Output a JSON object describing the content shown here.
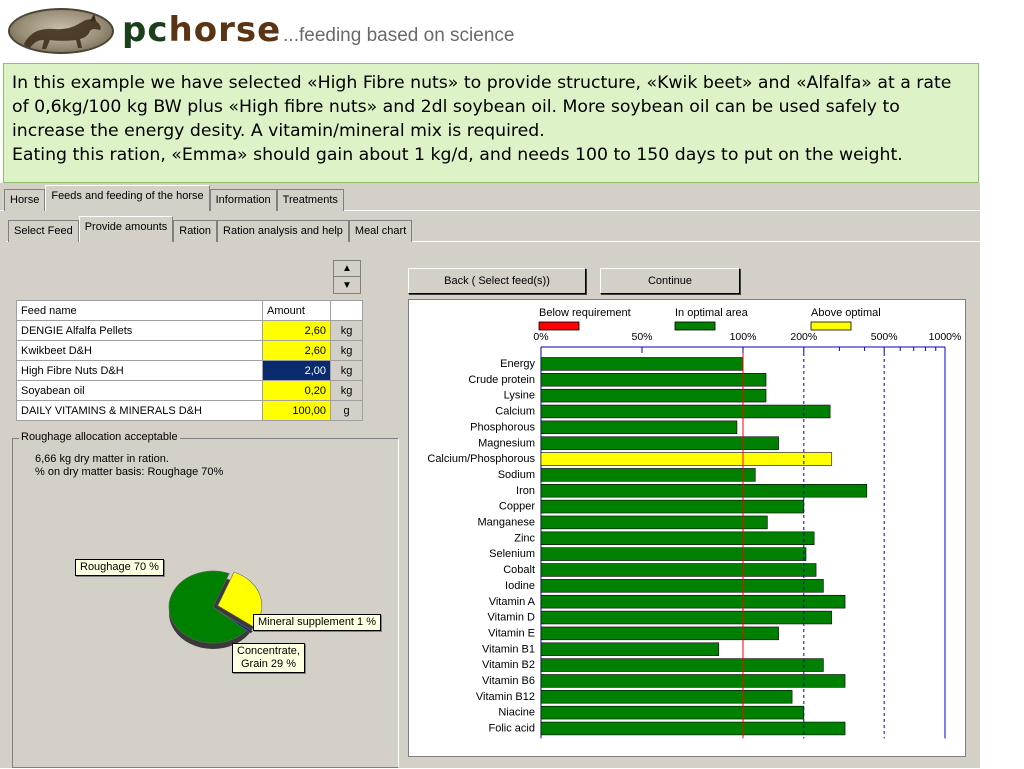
{
  "header": {
    "brand_pc": "pc",
    "brand_horse": "horse",
    "tagline": "...feeding based on science"
  },
  "caption": {
    "line1": "In this example we have selected «High Fibre nuts» to provide structure, «Kwik beet» and «Alfalfa» at a rate of 0,6kg/100 kg BW plus «High fibre nuts» and 2dl soybean oil. More soybean oil can be used safely to increase the energy desity.  A vitamin/mineral mix is required.",
    "line2": "Eating this ration, «Emma» should gain about 1 kg/d, and needs 100 to 150 days to put on the weight."
  },
  "tabs": {
    "main": [
      {
        "label": "Horse",
        "active": false
      },
      {
        "label": "Feeds and feeding of the horse",
        "active": true
      },
      {
        "label": "Information",
        "active": false
      },
      {
        "label": "Treatments",
        "active": false
      }
    ],
    "sub": [
      {
        "label": "Select Feed",
        "active": false
      },
      {
        "label": "Provide amounts",
        "active": true
      },
      {
        "label": "Ration",
        "active": false
      },
      {
        "label": "Ration analysis and help",
        "active": false
      },
      {
        "label": "Meal chart",
        "active": false
      }
    ]
  },
  "buttons": {
    "back": "Back ( Select feed(s))",
    "continue": "Continue"
  },
  "feed_table": {
    "headers": {
      "name": "Feed name",
      "amount": "Amount"
    },
    "rows": [
      {
        "name": "DENGIE Alfalfa Pellets",
        "amount": "2,60",
        "unit": "kg",
        "selected": false
      },
      {
        "name": "Kwikbeet D&H",
        "amount": "2,60",
        "unit": "kg",
        "selected": false
      },
      {
        "name": "High Fibre Nuts D&H",
        "amount": "2,00",
        "unit": "kg",
        "selected": true
      },
      {
        "name": "Soyabean oil",
        "amount": "0,20",
        "unit": "kg",
        "selected": false
      },
      {
        "name": "DAILY VITAMINS & MINERALS D&H",
        "amount": "100,00",
        "unit": "g",
        "selected": false
      }
    ]
  },
  "roughage": {
    "title": "Roughage allocation acceptable",
    "line1": "6,66 kg dry matter in ration.",
    "line2": "% on dry matter basis: Roughage 70%",
    "pie_labels": {
      "roughage": "Roughage 70 %",
      "mineral": "Mineral supplement 1 %",
      "concentrate_1": "Concentrate,",
      "concentrate_2": "Grain 29 %"
    }
  },
  "colors": {
    "below": "#ff0000",
    "optimal": "#008000",
    "above": "#ffff00",
    "selected_cell": "#0a2a6e",
    "amount_cell": "#ffff00",
    "caption_bg": "#ddf2c6"
  },
  "chart_data": [
    {
      "type": "pie",
      "categories": [
        "Roughage",
        "Concentrate, Grain",
        "Mineral supplement"
      ],
      "values": [
        70,
        29,
        1
      ],
      "colors": [
        "#008000",
        "#ffff00",
        "#1a1a80"
      ]
    },
    {
      "type": "bar",
      "orientation": "horizontal",
      "legend": [
        {
          "name": "Below requirement",
          "color": "#ff0000"
        },
        {
          "name": "In optimal area",
          "color": "#008000"
        },
        {
          "name": "Above optimal",
          "color": "#ffff00"
        }
      ],
      "legend_placement": "top",
      "x_scale": "log",
      "xlim": [
        0,
        1000
      ],
      "x_ticks": [
        "0%",
        "50%",
        "100%",
        "200%",
        "500%",
        "1000%"
      ],
      "reference_line": 100,
      "dotted_lines": [
        200,
        500
      ],
      "categories": [
        "Energy",
        "Crude protein",
        "Lysine",
        "Calcium",
        "Phosphorous",
        "Magnesium",
        "Calcium/Phosphorous",
        "Sodium",
        "Iron",
        "Copper",
        "Manganese",
        "Zinc",
        "Selenium",
        "Cobalt",
        "Iodine",
        "Vitamin A",
        "Vitamin D",
        "Vitamin E",
        "Vitamin B1",
        "Vitamin B2",
        "Vitamin B6",
        "Vitamin B12",
        "Niacine",
        "Folic acid"
      ],
      "values": [
        100,
        130,
        130,
        270,
        97,
        150,
        275,
        115,
        410,
        200,
        132,
        225,
        205,
        230,
        250,
        320,
        275,
        150,
        88,
        250,
        320,
        175,
        200,
        320
      ],
      "status": [
        "optimal",
        "optimal",
        "optimal",
        "optimal",
        "optimal",
        "optimal",
        "above",
        "optimal",
        "optimal",
        "optimal",
        "optimal",
        "optimal",
        "optimal",
        "optimal",
        "optimal",
        "optimal",
        "optimal",
        "optimal",
        "optimal",
        "optimal",
        "optimal",
        "optimal",
        "optimal",
        "optimal"
      ]
    }
  ]
}
